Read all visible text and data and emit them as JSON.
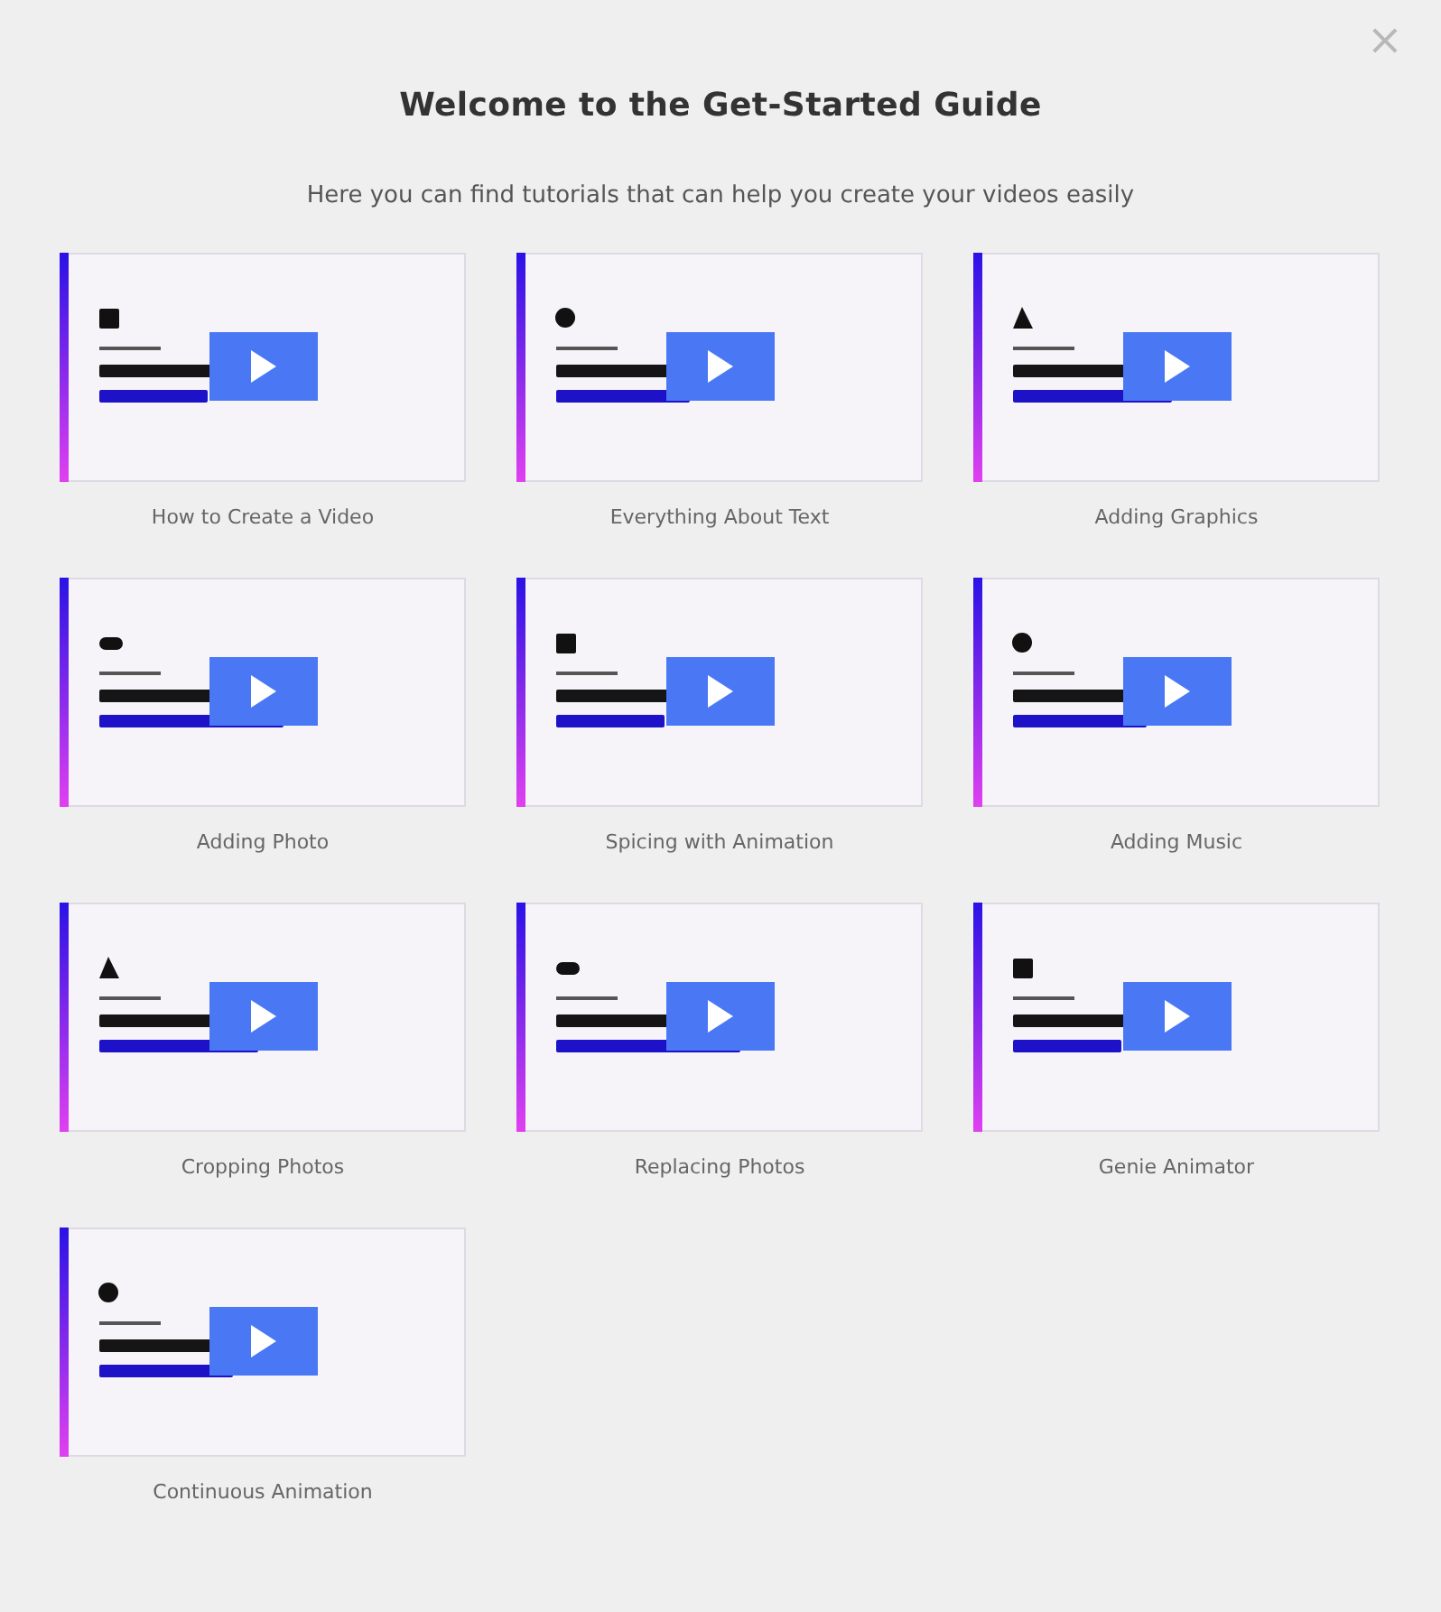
{
  "dialog": {
    "close": "×",
    "title": "Welcome to the Get-Started Guide",
    "subtitle": "Here you can find tutorials that can help you create your videos easily"
  },
  "videos": [
    {
      "caption": "How to Create a Video"
    },
    {
      "caption": "Everything About Text"
    },
    {
      "caption": "Adding Graphics"
    },
    {
      "caption": "Adding Photo"
    },
    {
      "caption": "Spicing with Animation"
    },
    {
      "caption": "Adding Music"
    },
    {
      "caption": "Cropping Photos"
    },
    {
      "caption": "Replacing Photos"
    },
    {
      "caption": "Genie Animator"
    },
    {
      "caption": "Continuous Animation"
    }
  ]
}
